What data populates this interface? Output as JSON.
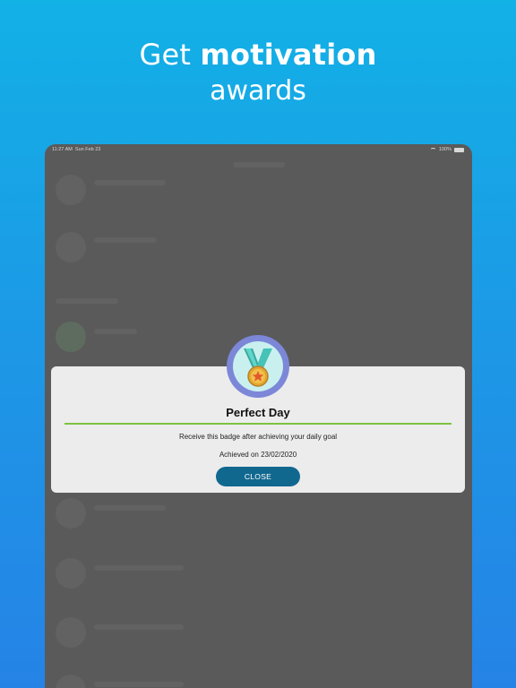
{
  "headline": {
    "prefix": "Get ",
    "emphasis": "motivation",
    "line2": "awards"
  },
  "statusbar": {
    "time": "11:27 AM",
    "date": "Sun Feb 23",
    "battery": "100%"
  },
  "dialog": {
    "badge_icon": "medal-icon",
    "title": "Perfect Day",
    "description": "Receive this badge after achieving your daily goal",
    "achieved": "Achieved on 23/02/2020",
    "close_label": "CLOSE"
  },
  "colors": {
    "accent": "#11688f",
    "divider": "#7ec23e",
    "medal_ring": "#7c87d8",
    "background_top": "#12b1e6",
    "background_bottom": "#2583e6"
  }
}
